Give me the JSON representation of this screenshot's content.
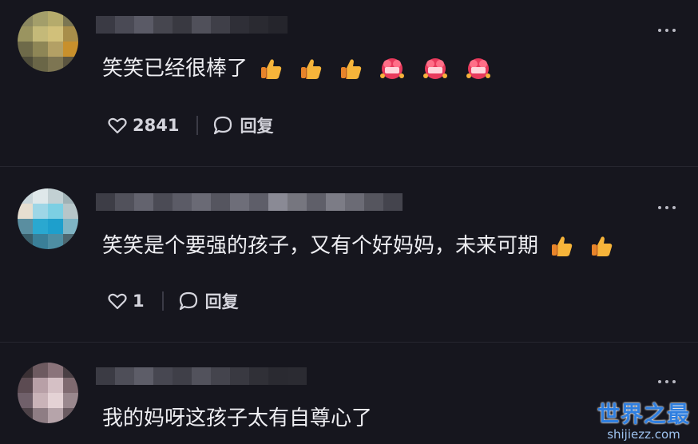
{
  "comments": [
    {
      "text": "笑笑已经很棒了",
      "emojis": [
        "thumbs-up",
        "thumbs-up",
        "thumbs-up",
        "heart-badge",
        "heart-badge",
        "heart-badge"
      ],
      "like_count": "2841",
      "reply_label": "回复"
    },
    {
      "text": "笑笑是个要强的孩子，又有个好妈妈，未来可期",
      "emojis": [
        "thumbs-up",
        "thumbs-up"
      ],
      "like_count": "1",
      "reply_label": "回复"
    },
    {
      "text": "我的妈呀这孩子太有自尊心了",
      "emojis": [],
      "like_count": "",
      "reply_label": ""
    }
  ],
  "watermark": {
    "title": "世界之最",
    "url": "shijiezz.com"
  },
  "colors": {
    "background": "#16161e",
    "text": "#eeeef2",
    "watermark_blue": "#2f7fe0"
  }
}
